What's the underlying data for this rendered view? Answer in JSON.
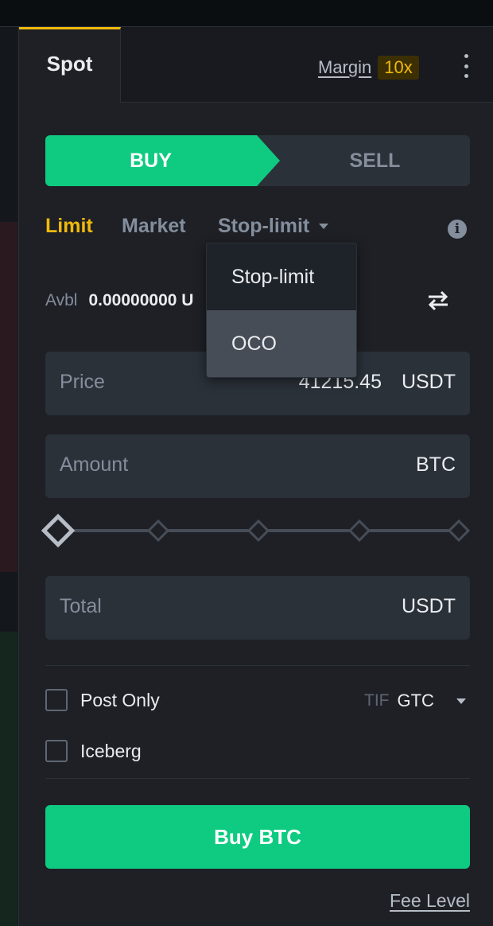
{
  "tabs": {
    "spot": "Spot",
    "margin": "Margin",
    "leverage": "10x"
  },
  "side": {
    "buy": "BUY",
    "sell": "SELL"
  },
  "order_types": {
    "limit": "Limit",
    "market": "Market",
    "stop_limit": "Stop-limit"
  },
  "dropdown": {
    "items": [
      "Stop-limit",
      "OCO"
    ],
    "highlighted": "OCO"
  },
  "avbl": {
    "label": "Avbl",
    "value": "0.00000000 U"
  },
  "price": {
    "label": "Price",
    "value": "41215.45",
    "unit": "USDT"
  },
  "amount": {
    "label": "Amount",
    "unit": "BTC"
  },
  "total": {
    "label": "Total",
    "unit": "USDT"
  },
  "options": {
    "post_only": "Post Only",
    "iceberg": "Iceberg",
    "tif_label": "TIF",
    "tif_value": "GTC"
  },
  "actions": {
    "buy": "Buy BTC",
    "fee_level": "Fee Level"
  },
  "colors": {
    "accent_yellow": "#f0b90b",
    "buy_green": "#0ecb81",
    "panel_bg": "#1e2026",
    "field_bg": "#2b3139"
  },
  "slider": {
    "value_percent": 0
  }
}
